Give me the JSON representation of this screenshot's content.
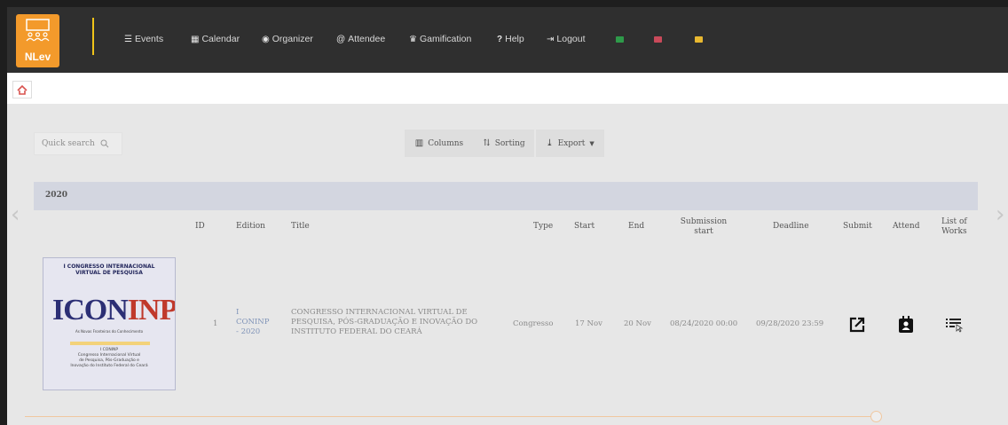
{
  "app": {
    "logo_text": "NLev"
  },
  "nav": {
    "items": [
      {
        "label": "Events",
        "icon": "list-icon"
      },
      {
        "label": "Calendar",
        "icon": "calendar-icon"
      },
      {
        "label": "Organizer",
        "icon": "user-circle-icon"
      },
      {
        "label": "Attendee",
        "icon": "at-icon"
      },
      {
        "label": "Gamification",
        "icon": "trophy-icon"
      },
      {
        "label": "Help",
        "icon": "question-icon"
      },
      {
        "label": "Logout",
        "icon": "logout-icon"
      }
    ],
    "flags": [
      {
        "name": "brazil-flag",
        "color": "#2e9a4a"
      },
      {
        "name": "usa-flag",
        "color": "#c94a5a"
      },
      {
        "name": "spain-flag",
        "color": "#e8b830"
      }
    ]
  },
  "toolbar": {
    "search_placeholder": "Quick search",
    "columns_label": "Columns",
    "sorting_label": "Sorting",
    "export_label": "Export"
  },
  "table": {
    "group": "2020",
    "headers": {
      "id": "ID",
      "edition": "Edition",
      "title": "Title",
      "type": "Type",
      "start": "Start",
      "end": "End",
      "submission_start_1": "Submission",
      "submission_start_2": "start",
      "deadline": "Deadline",
      "submit": "Submit",
      "attend": "Attend",
      "list_1": "List of",
      "list_2": "Works"
    },
    "row": {
      "id": "1",
      "edition_1": "I",
      "edition_2": "CONINP",
      "edition_3": "- 2020",
      "title_1": "CONGRESSO INTERNACIONAL VIRTUAL DE",
      "title_2": "PESQUISA, PÓS-GRADUAÇÃO E INOVAÇÃO DO",
      "title_3": "INSTITUTO FEDERAL DO CEARÁ",
      "type": "Congresso",
      "start": "17 Nov",
      "end": "20 Nov",
      "submission_start": "08/24/2020 00:00",
      "deadline": "09/28/2020 23:59"
    }
  },
  "poster": {
    "head_1": "I CONGRESSO INTERNACIONAL",
    "head_2": "VIRTUAL DE PESQUISA",
    "logo_a": "ICON",
    "logo_b": "INP",
    "sub": "As Novas Fronteiras do Conhecimento",
    "desc_1": "I CONINP",
    "desc_2": "Congresso Internacional Virtual",
    "desc_3": "de Pesquisa, Pós-Graduação e",
    "desc_4": "Inovação do Instituto Federal do Ceará"
  }
}
